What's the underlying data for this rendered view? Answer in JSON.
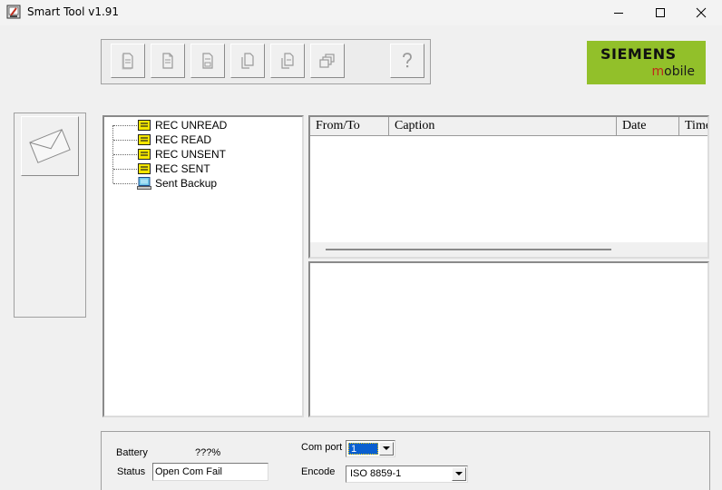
{
  "window": {
    "title": "Smart Tool v1.91",
    "icon": "app-icon",
    "controls": [
      "minimize-icon",
      "maximize-icon",
      "close-icon"
    ]
  },
  "toolbar": {
    "buttons": [
      {
        "icon": "doc-new-icon"
      },
      {
        "icon": "doc-open-icon"
      },
      {
        "icon": "doc-save-icon"
      },
      {
        "icon": "doc-copy-icon"
      },
      {
        "icon": "doc-paste-icon"
      },
      {
        "icon": "doc-stack-icon"
      },
      {
        "icon": "help-icon",
        "label": "?"
      }
    ]
  },
  "logo": {
    "line1": "SIEMENS",
    "line2_first": "m",
    "line2_rest": "obile",
    "colors": {
      "background": "#92c02a",
      "m": "#c0291a"
    }
  },
  "left_panel": {
    "compose_icon": "envelope-icon"
  },
  "folders": [
    {
      "label": "REC UNREAD",
      "icon": "inbox-folder-icon"
    },
    {
      "label": "REC READ",
      "icon": "inbox-folder-icon"
    },
    {
      "label": "REC UNSENT",
      "icon": "inbox-folder-icon"
    },
    {
      "label": "REC SENT",
      "icon": "inbox-folder-icon"
    },
    {
      "label": "Sent Backup",
      "icon": "computer-icon"
    }
  ],
  "message_list": {
    "columns": [
      "From/To",
      "Caption",
      "Date",
      "Time"
    ],
    "rows": []
  },
  "bottom": {
    "battery_label": "Battery",
    "battery_value": "???%",
    "status_label": "Status",
    "status_value": "Open Com Fail",
    "comport_label": "Com port",
    "comport_value": "1",
    "encode_label": "Encode",
    "encode_value": "ISO 8859-1"
  }
}
